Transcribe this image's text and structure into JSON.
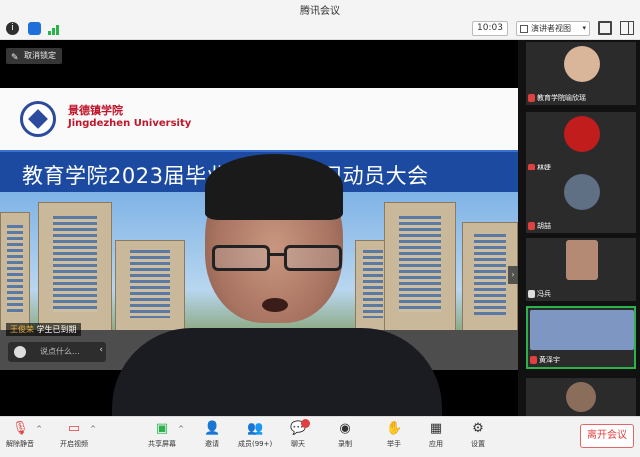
{
  "app": {
    "title": "腾讯会议"
  },
  "topbar": {
    "clock": "10:03",
    "view_label": "演讲者视图",
    "view_caret": "▾"
  },
  "stage": {
    "unpin_label": "取消锁定",
    "slide": {
      "university_cn": "景德镇学院",
      "university_en": "Jingdezhen University",
      "banner_text": "教育学院2023届毕业生 教育实习动员大会"
    },
    "speaker_name": "王俊荣",
    "speaker_status": "学生已到期",
    "chat_placeholder": "说点什么...",
    "collapse_glyph": "›"
  },
  "sidebar": {
    "participants": [
      {
        "name": "教育学院喻欣瑶",
        "muted": true,
        "avatar_color": "#d9b59a"
      },
      {
        "name": "林婕",
        "muted": true,
        "avatar_color": "#c21d1d"
      },
      {
        "name": "胡喆",
        "muted": true,
        "avatar_color": "#5f6f84"
      },
      {
        "name": "冯兵",
        "muted": false,
        "avatar_color": "#b48a74"
      },
      {
        "name": "黄泽宇",
        "muted": true,
        "avatar_color": "#7d96c2"
      },
      {
        "name": "",
        "muted": true,
        "avatar_color": "#8a6d5a"
      }
    ]
  },
  "controls": {
    "unmute": "解除静音",
    "start_video": "开启视频",
    "share_screen": "共享屏幕",
    "invite": "邀请",
    "members": "成员(99+)",
    "chat": "聊天",
    "record": "录制",
    "raise_hand": "举手",
    "apps": "应用",
    "settings": "设置",
    "leave": "离开会议",
    "chat_badge": ""
  }
}
